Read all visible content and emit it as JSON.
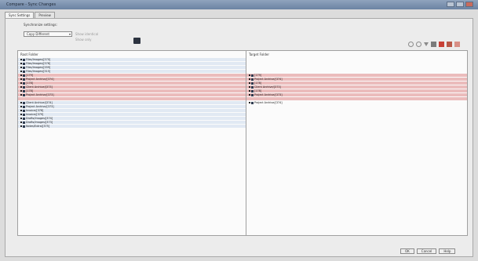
{
  "window": {
    "title": "Compare - Sync Changes"
  },
  "tabs": [
    {
      "label": "Sync Settings"
    },
    {
      "label": "Preview"
    }
  ],
  "settings": {
    "label": "Synchronize settings:",
    "combo_value": "Copy Different",
    "option_checkbox": "Show identical",
    "option_radio": "Show only"
  },
  "left_pane": {
    "header": "Root Folder",
    "rows": [
      {
        "label": "Files/Images/[370]",
        "style": "blue"
      },
      {
        "label": "Files/Images/[376]",
        "style": "blue"
      },
      {
        "label": "Files/Images/[359]",
        "style": "blue"
      },
      {
        "label": "Files/Images/[315]",
        "style": "blue"
      },
      {
        "label": "[179]",
        "style": "diff"
      },
      {
        "label": "Project Archive/[374]",
        "style": "diff"
      },
      {
        "label": "[178]",
        "style": "diff"
      },
      {
        "label": "Client Archive/[373]",
        "style": "diff"
      },
      {
        "label": "[178]",
        "style": "diff"
      },
      {
        "label": "Project Archive/[373]",
        "style": "diff"
      },
      {
        "label": "",
        "style": "diff"
      },
      {
        "label": "Client Archive/[374]",
        "style": "blue"
      },
      {
        "label": "Project Archive/[373]",
        "style": "blue"
      },
      {
        "label": "Invoice/[378]",
        "style": "blue"
      },
      {
        "label": "Invoice/[379]",
        "style": "blue"
      },
      {
        "label": "Drafts/Images/[374]",
        "style": "blue"
      },
      {
        "label": "Drafts/Images/[373]",
        "style": "blue"
      },
      {
        "label": "Notes/Extra/[375]",
        "style": "blue"
      }
    ]
  },
  "right_pane": {
    "header": "Target Folder",
    "rows": [
      {
        "label": "",
        "style": "none"
      },
      {
        "label": "",
        "style": "none"
      },
      {
        "label": "",
        "style": "none"
      },
      {
        "label": "",
        "style": "none"
      },
      {
        "label": "[179]",
        "style": "diff"
      },
      {
        "label": "Project Archive/[374]",
        "style": "diff"
      },
      {
        "label": "[178]",
        "style": "diff"
      },
      {
        "label": "Client Archive/[373]",
        "style": "diff"
      },
      {
        "label": "[178]",
        "style": "diff"
      },
      {
        "label": "Project Archive/[373]",
        "style": "diff"
      },
      {
        "label": "",
        "style": "diff"
      },
      {
        "label": "Project Archive/[374]",
        "style": "none"
      }
    ]
  },
  "footer": {
    "ok": "OK",
    "cancel": "Cancel",
    "help": "Help"
  },
  "colors": {
    "diff_row": "#ebbcbc",
    "selected_row": "#e1e9f3",
    "title_bar": "#7b90ad"
  }
}
